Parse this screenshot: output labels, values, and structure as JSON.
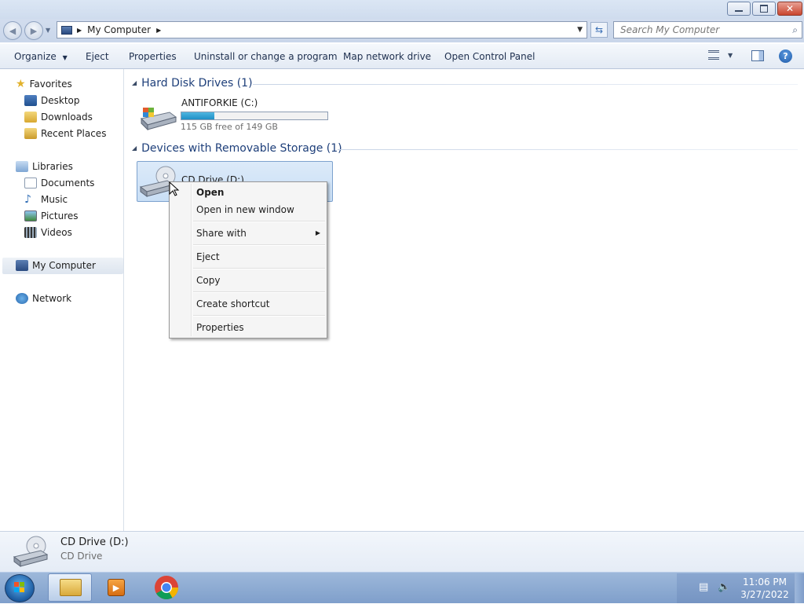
{
  "window": {
    "address_location": "My Computer",
    "search_placeholder": "Search My Computer"
  },
  "command_bar": {
    "organize": "Organize",
    "eject": "Eject",
    "properties": "Properties",
    "uninstall": "Uninstall or change a program",
    "map_drive": "Map network drive",
    "control_panel": "Open Control Panel"
  },
  "nav": {
    "favorites": "Favorites",
    "desktop": "Desktop",
    "downloads": "Downloads",
    "recent": "Recent Places",
    "libraries": "Libraries",
    "documents": "Documents",
    "music": "Music",
    "pictures": "Pictures",
    "videos": "Videos",
    "computer": "My Computer",
    "network": "Network"
  },
  "content": {
    "hdd_group": "Hard Disk Drives (1)",
    "drive_c_name": "ANTIFORKIE (C:)",
    "drive_c_free": "115 GB free of 149 GB",
    "drive_c_used_fraction": 0.228,
    "removable_group": "Devices with Removable Storage (1)",
    "drive_d_name": "CD Drive (D:)"
  },
  "context_menu": {
    "open": "Open",
    "open_new_window": "Open in new window",
    "share_with": "Share with",
    "eject": "Eject",
    "copy": "Copy",
    "create_shortcut": "Create shortcut",
    "properties": "Properties"
  },
  "details": {
    "name": "CD Drive (D:)",
    "type": "CD Drive"
  },
  "taskbar": {
    "time": "11:06 PM",
    "date": "3/27/2022"
  },
  "colors": {
    "accent": "#1f8fc5",
    "selection": "#c9dff6",
    "group_header": "#1e3f7a",
    "taskbar": "#8aa7d0"
  }
}
